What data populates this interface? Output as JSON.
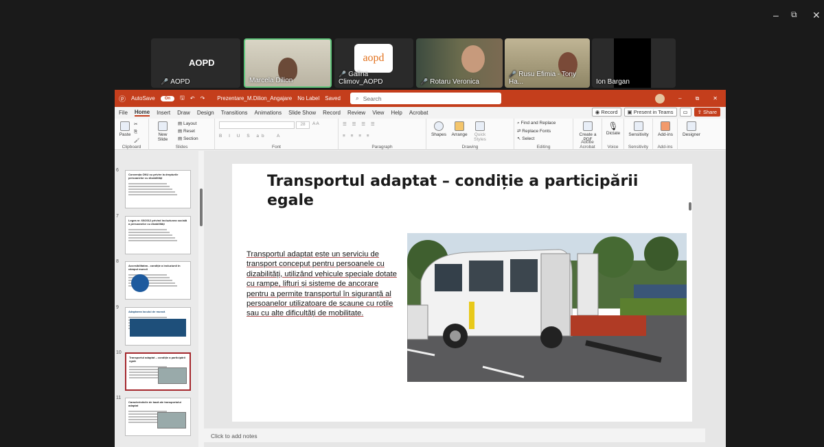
{
  "window_controls": {
    "minimize": "–",
    "restore": "⧉",
    "close": "✕"
  },
  "meeting": {
    "organizer_tile": {
      "big_name": "AOPD",
      "label": "AOPD"
    },
    "participants": [
      {
        "name": "Marcela Dilion"
      },
      {
        "name": "Galina Climov_AOPD",
        "logo_text": "aopd"
      },
      {
        "name": "Rotaru Veronica"
      },
      {
        "name": "Rusu Efimia - Tony Ha..."
      },
      {
        "name": "Ion Bargan"
      }
    ]
  },
  "ppt": {
    "titlebar": {
      "autosave": "AutoSave",
      "toggle": "On",
      "filename": "Prezentare_M.Dilion_Angajare",
      "label": "No Label",
      "saved": "Saved",
      "search": "Search"
    },
    "menu": [
      "File",
      "Home",
      "Insert",
      "Draw",
      "Design",
      "Transitions",
      "Animations",
      "Slide Show",
      "Record",
      "Review",
      "View",
      "Help",
      "Acrobat"
    ],
    "menu_right": {
      "record": "Record",
      "present": "Present in Teams",
      "share": "Share"
    },
    "ribbon": {
      "groups": [
        "Clipboard",
        "Slides",
        "Font",
        "Paragraph",
        "Drawing",
        "Editing",
        "Adobe Acrobat",
        "Voice",
        "Sensitivity",
        "Add-ins"
      ],
      "paste": "Paste",
      "new_slide": "New Slide",
      "layout": "Layout",
      "reset": "Reset",
      "section": "Section",
      "shapes": "Shapes",
      "arrange": "Arrange",
      "quick_styles": "Quick Styles",
      "find_replace": "Find and Replace",
      "replace_fonts": "Replace Fonts",
      "select": "Select",
      "create_pdf": "Create a PDF",
      "dictate": "Dictate",
      "sensitivity": "Sensitivity",
      "addins": "Add-ins",
      "designer": "Designer",
      "font_size": "28"
    },
    "thumbnails": [
      {
        "num": "6",
        "title": "Convenția ONU cu privire la drepturile persoanelor cu dizabilități"
      },
      {
        "num": "7",
        "title": "Legea nr. 60/2012 privind incluziunea socială a persoanelor cu dizabilități"
      },
      {
        "num": "8",
        "title": "Accesibilitatea - condiție a incluziunii în câmpul muncii"
      },
      {
        "num": "9",
        "title": "Adaptarea locului de muncă"
      },
      {
        "num": "10",
        "title": "Transportul adaptat – condiție a participării egale"
      },
      {
        "num": "11",
        "title": "Caracteristicile de bază ale transportului adaptat"
      }
    ],
    "slide": {
      "title": "Transportul adaptat – condiție a participării egale",
      "body": "Transportul adaptat este un serviciu de transport conceput pentru persoanele cu dizabilități, utilizând vehicule speciale dotate cu rampe, lifturi și sisteme de ancorare pentru a permite transportul în siguranță al persoanelor utilizatoare de scaune cu rotile sau cu alte dificultăți de mobilitate."
    },
    "notes_placeholder": "Click to add notes"
  },
  "colors": {
    "accent": "#c43e1c",
    "selected_thumb": "#a4262c"
  }
}
